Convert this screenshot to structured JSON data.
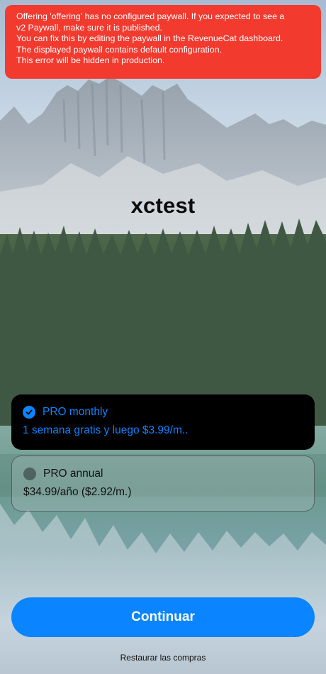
{
  "error_banner": {
    "lines": [
      "Offering 'offering' has no configured paywall. If you expected to see a",
      "v2 Paywall, make sure it is published.",
      "You can fix this by editing the paywall in the RevenueCat dashboard.",
      "The displayed paywall contains default configuration.",
      "This error will be hidden in production."
    ]
  },
  "paywall": {
    "title": "xctest",
    "packages": [
      {
        "name": "PRO monthly",
        "description": "1 semana gratis y luego $3.99/m..",
        "selected": true,
        "icon": "checkmark-circle-icon"
      },
      {
        "name": "PRO annual",
        "description": "$34.99/año ($2.92/m.)",
        "selected": false,
        "icon": "radio-circle-icon"
      }
    ],
    "continue_label": "Continuar",
    "restore_label": "Restaurar las compras"
  },
  "colors": {
    "accent": "#0a84ff",
    "error": "#f23a2f"
  }
}
